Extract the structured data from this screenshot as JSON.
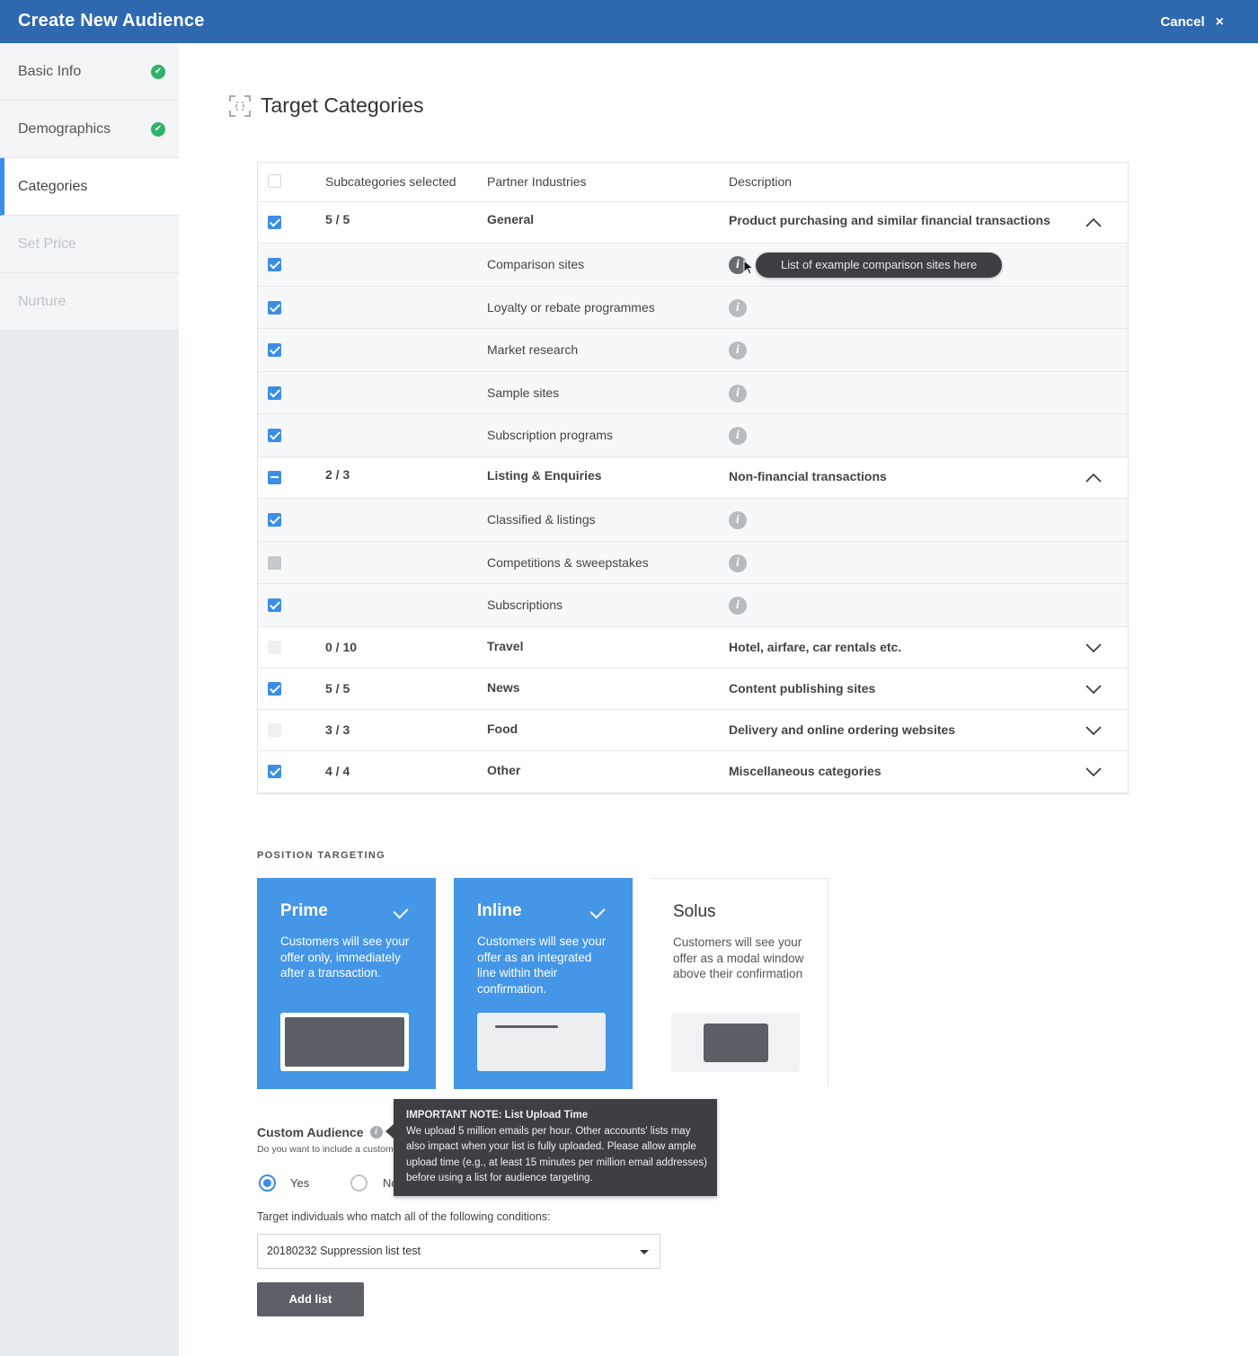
{
  "header": {
    "title": "Create New Audience",
    "cancel_label": "Cancel",
    "close_glyph": "×"
  },
  "sidebar": {
    "items": [
      {
        "label": "Basic Info",
        "state": "complete"
      },
      {
        "label": "Demographics",
        "state": "complete"
      },
      {
        "label": "Categories",
        "state": "active"
      },
      {
        "label": "Set Price",
        "state": "disabled"
      },
      {
        "label": "Nurture",
        "state": "disabled"
      }
    ]
  },
  "main": {
    "title": "Target Categories",
    "table": {
      "headers": {
        "selected": "Subcategories selected",
        "industries": "Partner Industries",
        "description": "Description"
      },
      "groups": [
        {
          "count": "5 / 5",
          "name": "General",
          "description": "Product purchasing and similar financial transactions",
          "check": "checked",
          "expanded": true,
          "children": [
            {
              "name": "Comparison sites",
              "check": "checked",
              "tooltip": "List of example comparison sites here"
            },
            {
              "name": "Loyalty or rebate programmes",
              "check": "checked"
            },
            {
              "name": "Market research",
              "check": "checked"
            },
            {
              "name": "Sample sites",
              "check": "checked"
            },
            {
              "name": "Subscription programs",
              "check": "checked"
            }
          ]
        },
        {
          "count": "2 / 3",
          "name": "Listing & Enquiries",
          "description": "Non-financial transactions",
          "check": "partial",
          "expanded": true,
          "children": [
            {
              "name": "Classified & listings",
              "check": "checked"
            },
            {
              "name": "Competitions & sweepstakes",
              "check": "grey"
            },
            {
              "name": "Subscriptions",
              "check": "checked"
            }
          ]
        },
        {
          "count": "0 / 10",
          "name": "Travel",
          "description": "Hotel, airfare, car rentals etc.",
          "check": "light",
          "expanded": false
        },
        {
          "count": "5 / 5",
          "name": "News",
          "description": "Content publishing sites",
          "check": "checked",
          "expanded": false
        },
        {
          "count": "3 / 3",
          "name": "Food",
          "description": "Delivery and online ordering websites",
          "check": "light",
          "expanded": false
        },
        {
          "count": "4 / 4",
          "name": "Other",
          "description": "Miscellaneous categories",
          "check": "checked",
          "expanded": false
        }
      ]
    },
    "position_targeting": {
      "label": "POSITION TARGETING",
      "cards": [
        {
          "name": "Prime",
          "description": "Customers will see your offer only, immediately after a transaction.",
          "selected": true
        },
        {
          "name": "Inline",
          "description": "Customers will see your offer as an integrated line within their confirmation.",
          "selected": true
        },
        {
          "name": "Solus",
          "description": "Customers will see your offer as a modal window above their confirmation",
          "selected": false
        }
      ]
    },
    "custom_audience": {
      "title": "Custom Audience",
      "question": "Do you want to include a custom audience?",
      "yes_label": "Yes",
      "no_label": "No",
      "selected": "Yes",
      "note_title": "IMPORTANT NOTE: List Upload Time",
      "note_body": "We upload 5 million emails per hour. Other accounts' lists may also impact when your list is fully uploaded. Please allow ample upload time (e.g., at least 15 minutes per million email addresses) before using a list for audience targeting.",
      "conditions_label": "Target individuals who match all of the following conditions:",
      "list_value": "20180232 Suppression list test",
      "add_button": "Add list"
    }
  },
  "colors": {
    "header": "#2e68ae",
    "accent": "#3a8ee6",
    "card_selected": "#4496e6",
    "success": "#2fb36b",
    "tooltip": "#3d3f42"
  },
  "icons": {
    "complete": "check-circle-icon",
    "info": "info-icon",
    "expand": "chevron-down-icon",
    "collapse": "chevron-up-icon",
    "close": "close-icon",
    "section": "target-frame-icon"
  }
}
